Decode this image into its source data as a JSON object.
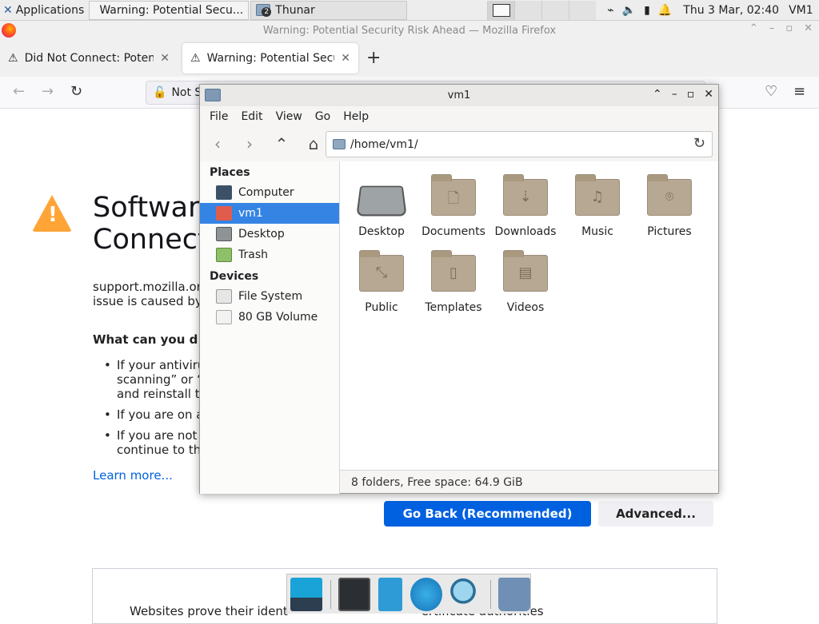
{
  "panel": {
    "applications": "Applications",
    "task_firefox": "Warning: Potential Secu...",
    "task_thunar": "Thunar",
    "task_thunar_badge": "2",
    "clock": "Thu  3 Mar, 02:40",
    "host": "VM1"
  },
  "firefox": {
    "window_title": "Warning: Potential Security Risk Ahead — Mozilla Firefox",
    "tabs": [
      {
        "label": "Did Not Connect: Potenti"
      },
      {
        "label": "Warning: Potential Secur"
      }
    ],
    "url_label": "Not S",
    "error_title": "Software\nConnect",
    "error_desc": "support.mozilla.or\nissue is caused by",
    "what_heading": "What can you d",
    "list": [
      "If your antiviru\nscanning” or “\nand reinstall t",
      "If you are on a",
      "If you are not\ncontinue to th"
    ],
    "learn_more": "Learn more...",
    "go_back": "Go Back (Recommended)",
    "advanced": "Advanced...",
    "adv_text": "Websites prove their ident                                   ertificate authorities"
  },
  "thunar": {
    "title": "vm1",
    "menu": [
      "File",
      "Edit",
      "View",
      "Go",
      "Help"
    ],
    "path": "/home/vm1/",
    "places_header": "Places",
    "places": [
      "Computer",
      "vm1",
      "Desktop",
      "Trash"
    ],
    "devices_header": "Devices",
    "devices": [
      "File System",
      "80 GB Volume"
    ],
    "items": [
      {
        "label": "Desktop",
        "glyph": ""
      },
      {
        "label": "Documents",
        "glyph": "🗋"
      },
      {
        "label": "Downloads",
        "glyph": "⇣"
      },
      {
        "label": "Music",
        "glyph": "♫"
      },
      {
        "label": "Pictures",
        "glyph": "⌾"
      },
      {
        "label": "Public",
        "glyph": "⤡"
      },
      {
        "label": "Templates",
        "glyph": "▯"
      },
      {
        "label": "Videos",
        "glyph": "▤"
      }
    ],
    "status": "8 folders, Free space: 64.9 GiB"
  },
  "colors": {
    "accent": "#3584e4",
    "ff_primary": "#0061e0",
    "warning": "#ffa436"
  }
}
